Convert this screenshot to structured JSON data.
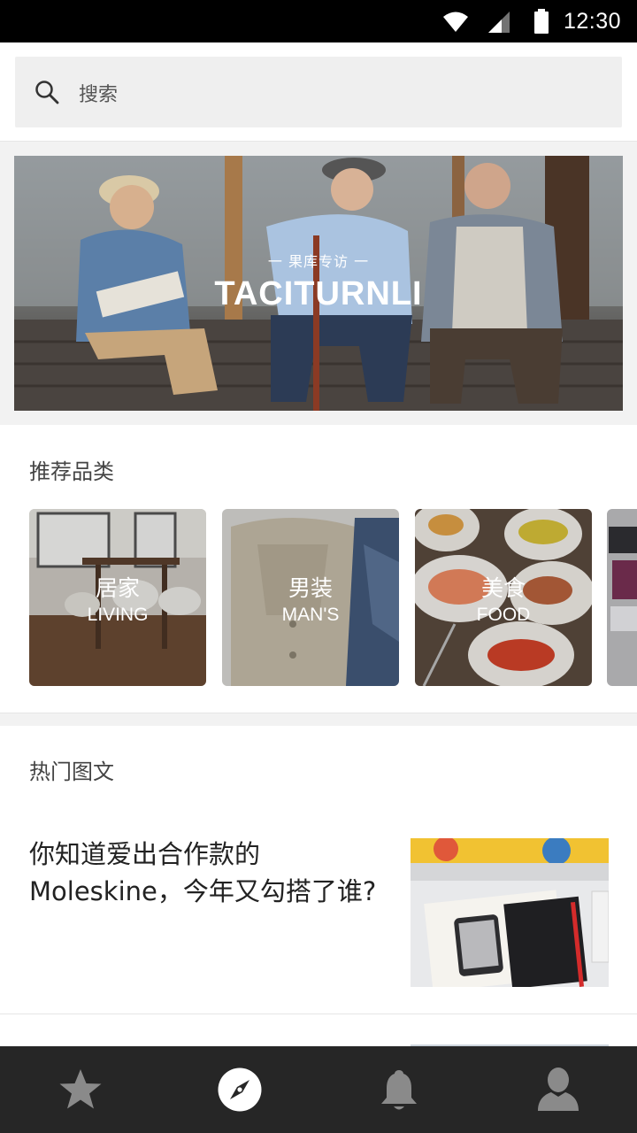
{
  "status_bar": {
    "time": "12:30"
  },
  "search": {
    "placeholder": "搜索",
    "icon": "search-icon"
  },
  "banner": {
    "tag": "一 果库专访 一",
    "title": "TACITURNLI"
  },
  "categories": {
    "title": "推荐品类",
    "items": [
      {
        "cn": "居家",
        "en": "LIVING"
      },
      {
        "cn": "男装",
        "en": "MAN'S"
      },
      {
        "cn": "美食",
        "en": "FOOD"
      }
    ]
  },
  "hot": {
    "title": "热门图文",
    "articles": [
      {
        "title": "你知道爱出合作款的 Moleskine，今年又勾搭了谁?"
      }
    ]
  },
  "tab_bar": {
    "active_color": "#ffffff",
    "inactive_color": "#8a8a8a",
    "tabs": [
      {
        "icon": "star-icon",
        "active": false
      },
      {
        "icon": "compass-icon",
        "active": true
      },
      {
        "icon": "bell-icon",
        "active": false
      },
      {
        "icon": "user-icon",
        "active": false
      }
    ]
  }
}
